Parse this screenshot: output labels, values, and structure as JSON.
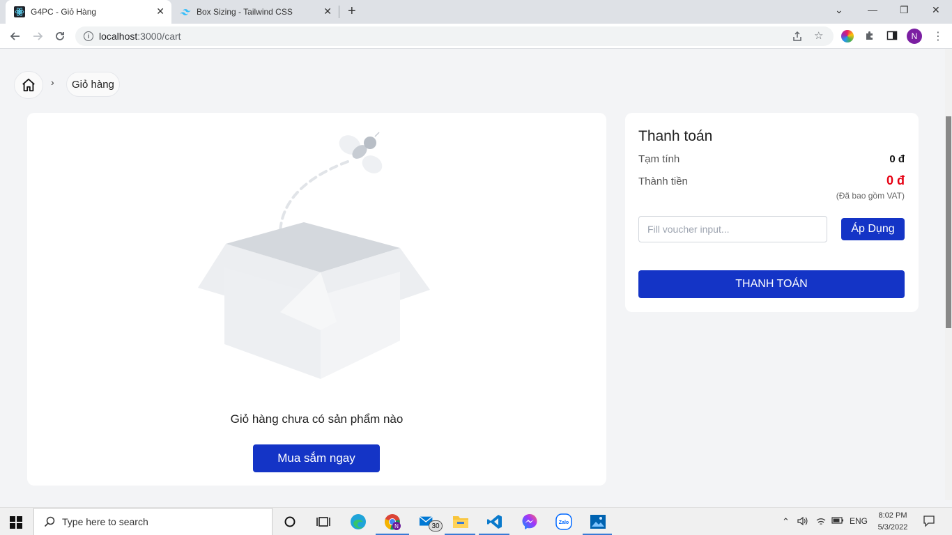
{
  "browser": {
    "tabs": [
      {
        "title": "G4PC - Giỏ Hàng",
        "active": true
      },
      {
        "title": "Box Sizing - Tailwind CSS",
        "active": false
      }
    ],
    "url_host": "localhost",
    "url_rest": ":3000/cart",
    "profile_initial": "N"
  },
  "breadcrumb": {
    "current": "Giỏ hàng"
  },
  "cart": {
    "empty_message": "Giỏ hàng chưa có sản phẩm nào",
    "shop_button": "Mua sắm ngay"
  },
  "payment": {
    "title": "Thanh toán",
    "subtotal_label": "Tạm tính",
    "subtotal_value": "0 đ",
    "total_label": "Thành tiền",
    "total_value": "0 đ",
    "vat_note": "(Đã bao gồm VAT)",
    "voucher_placeholder": "Fill voucher input...",
    "apply_button": "Áp Dụng",
    "checkout_button": "THANH TOÁN",
    "accent_color": "#1434c6",
    "total_color": "#e60012"
  },
  "taskbar": {
    "search_placeholder": "Type here to search",
    "mail_badge": "30",
    "language": "ENG",
    "time": "8:02 PM",
    "date": "5/3/2022"
  }
}
